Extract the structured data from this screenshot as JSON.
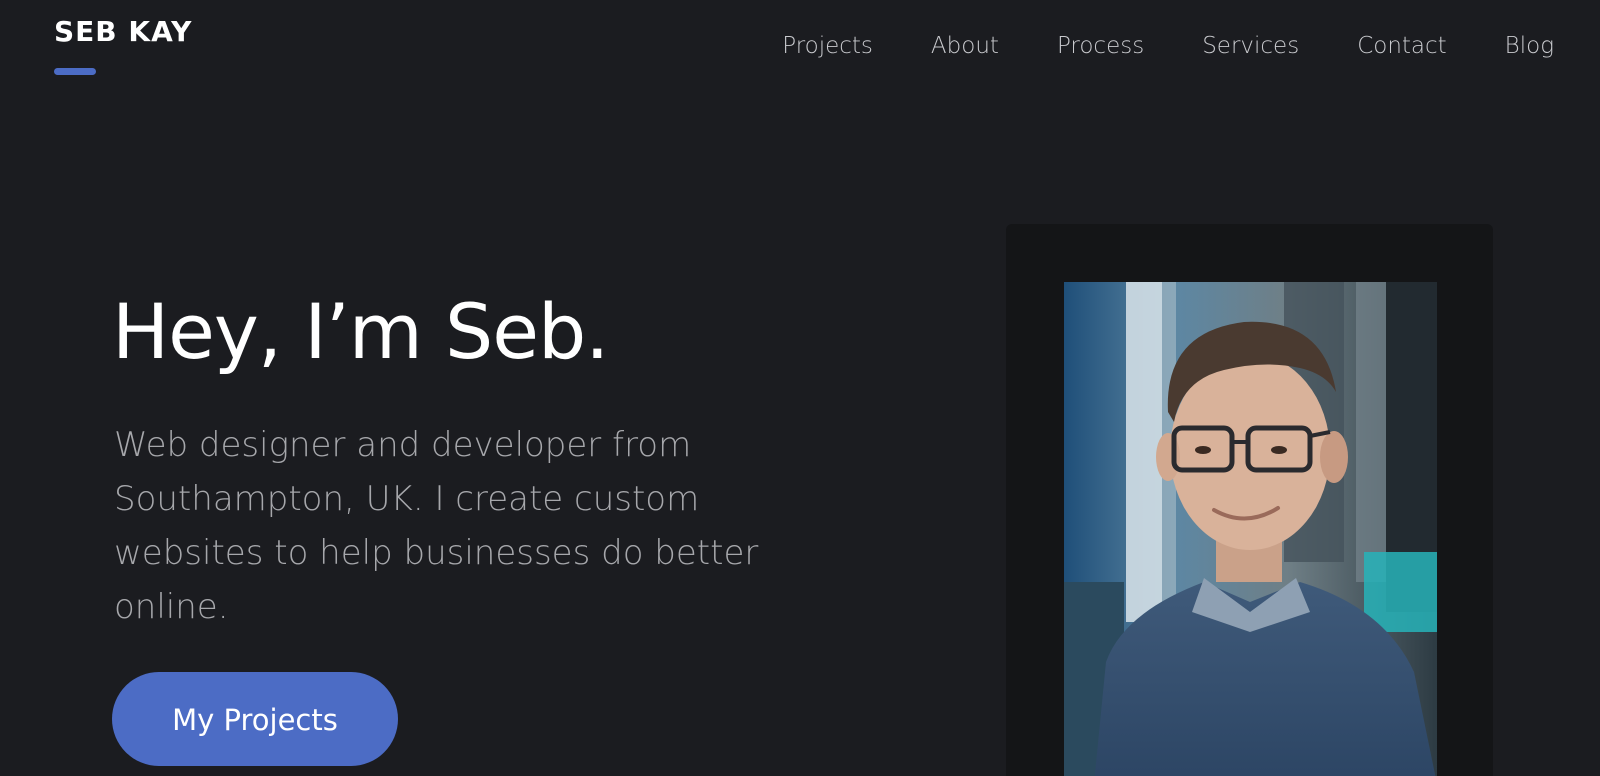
{
  "header": {
    "logo": "SEB KAY",
    "nav": [
      "Projects",
      "About",
      "Process",
      "Services",
      "Contact",
      "Blog"
    ]
  },
  "hero": {
    "title": "Hey, I’m Seb.",
    "description": "Web designer and developer from Southampton, UK. I create custom websites to help businesses do better online.",
    "cta_label": "My Projects"
  },
  "photo": {
    "subject": "portrait-photo"
  },
  "colors": {
    "background": "#1b1c20",
    "accent": "#4c6cc5",
    "frame": "#141517",
    "text_primary": "#ffffff",
    "text_secondary": "#a6a7ab"
  }
}
